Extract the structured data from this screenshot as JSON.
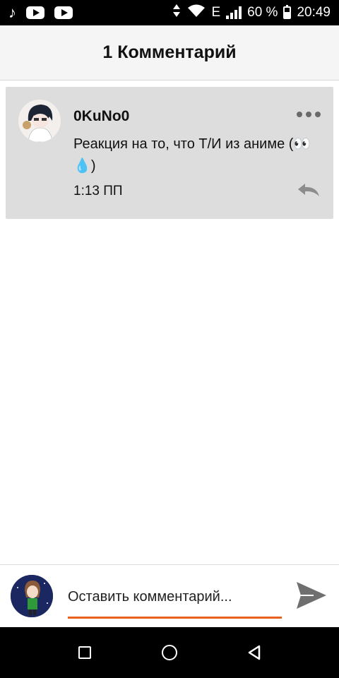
{
  "status_bar": {
    "icons": [
      "music-note-icon",
      "youtube-icon",
      "youtube-icon",
      "vibrate-icon",
      "wifi-icon",
      "signal-icon",
      "battery-icon"
    ],
    "network_type": "E",
    "battery": "60 %",
    "time": "20:49"
  },
  "header": {
    "title": "1 Комментарий"
  },
  "comment": {
    "username": "0KuNo0",
    "text": "Реакция на то, что Т/И из аниме (👀💧)",
    "time": "1:13 ПП"
  },
  "composer": {
    "placeholder": "Оставить комментарий..."
  },
  "colors": {
    "accent": "#e8611e",
    "card_background": "#dddddd",
    "header_background": "#f5f5f5"
  }
}
